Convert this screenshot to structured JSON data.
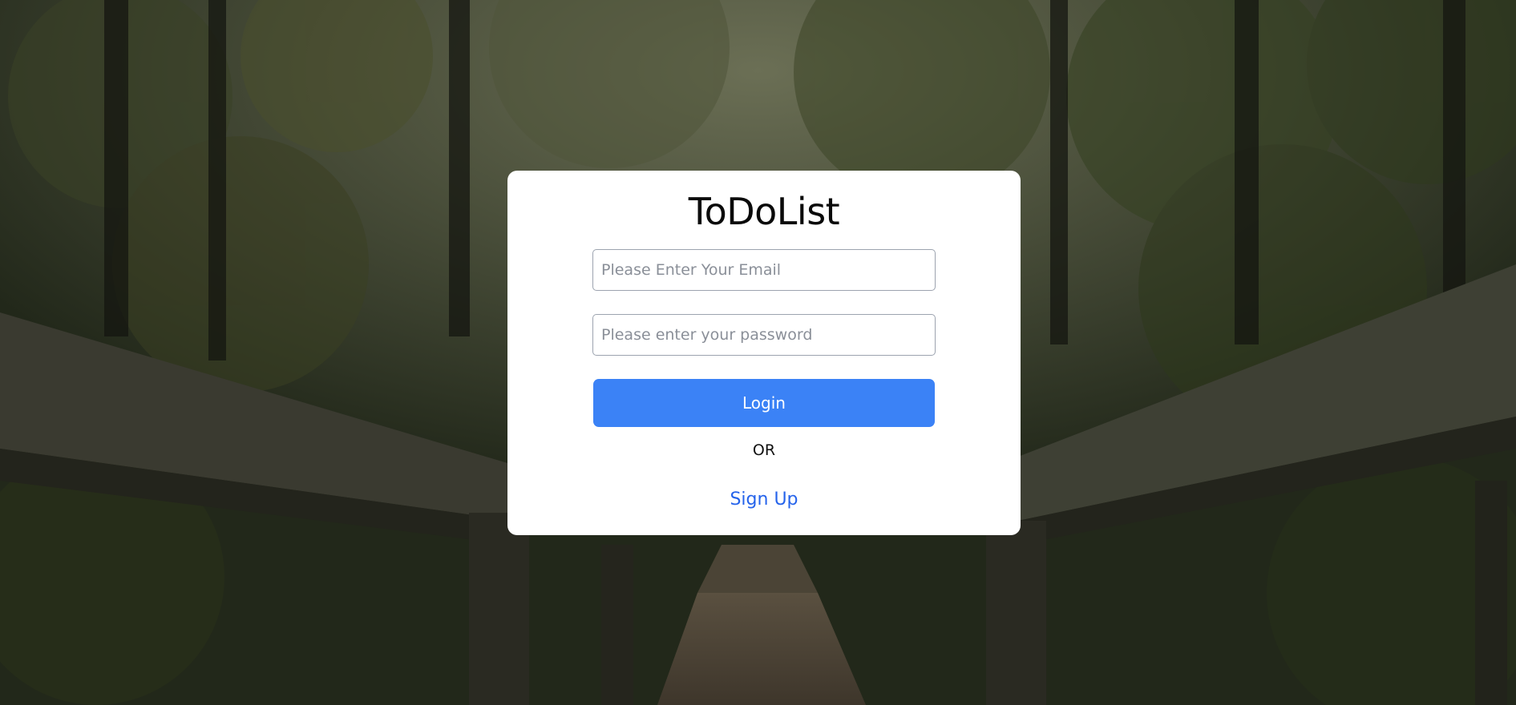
{
  "app": {
    "title": "ToDoList"
  },
  "login_form": {
    "email_placeholder": "Please Enter Your Email",
    "email_value": "",
    "password_placeholder": "Please enter your password",
    "password_value": "",
    "login_label": "Login",
    "or_label": "OR",
    "signup_label": "Sign Up"
  },
  "colors": {
    "login_button": "#3b82f6",
    "signup_link": "#2563eb",
    "card_background": "#ffffff"
  },
  "background": {
    "icon": "forest-boardwalk-photo"
  }
}
